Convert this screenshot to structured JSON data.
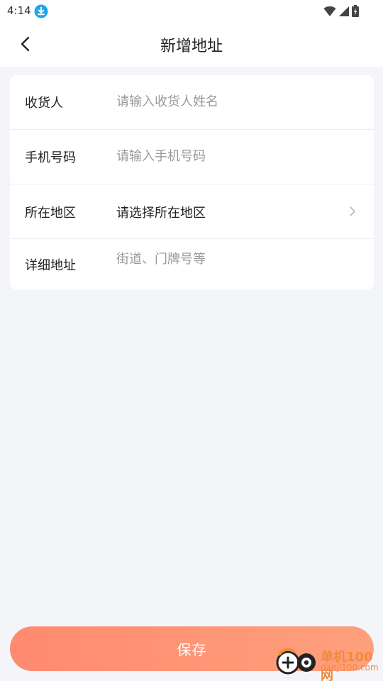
{
  "status_bar": {
    "time": "4:14",
    "download_icon": "download-circle-icon",
    "wifi_icon": "wifi-icon",
    "signal_icon": "cell-signal-icon",
    "battery_icon": "battery-charging-icon"
  },
  "header": {
    "title": "新增地址",
    "back_icon": "chevron-left-icon"
  },
  "form": {
    "receiver": {
      "label": "收货人",
      "value": "",
      "placeholder": "请输入收货人姓名"
    },
    "phone": {
      "label": "手机号码",
      "value": "",
      "placeholder": "请输入手机号码"
    },
    "region": {
      "label": "所在地区",
      "value": "请选择所在地区",
      "icon": "chevron-right-icon"
    },
    "detail": {
      "label": "详细地址",
      "value": "",
      "placeholder": "街道、门牌号等"
    }
  },
  "footer": {
    "save_label": "保存"
  },
  "watermark": {
    "title": "单机100网",
    "subtitle": "danji100.com"
  },
  "colors": {
    "page_bg": "#f4f5f9",
    "card_bg": "#ffffff",
    "accent_start": "#ff8a6f",
    "accent_end": "#ffa07c",
    "placeholder": "#9a9a9a",
    "download_badge": "#1aa6f0"
  }
}
